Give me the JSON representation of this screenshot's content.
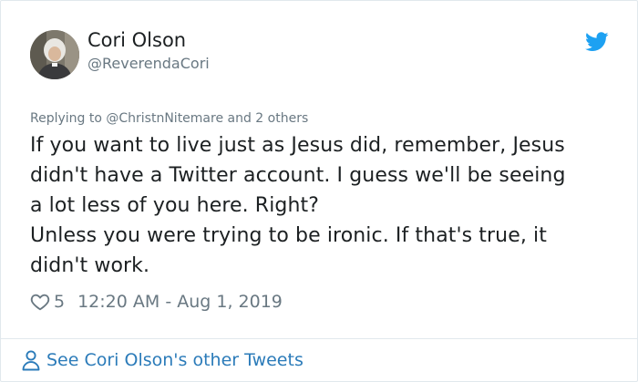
{
  "author": {
    "name": "Cori Olson",
    "handle": "@ReverendaCori"
  },
  "icons": {
    "brand": "twitter-bird-icon",
    "like": "heart-outline-icon",
    "profile": "person-outline-icon"
  },
  "reply": {
    "text": "Replying to @ChristnNitemare and 2 others"
  },
  "tweet": {
    "lines": [
      "If you want to live just as Jesus did, remember, Jesus",
      "didn't have a Twitter account. I guess we'll be seeing",
      "a lot less of you here. Right?",
      "Unless you were trying to be ironic. If that's true, it",
      "didn't work."
    ]
  },
  "meta": {
    "likes": "5",
    "timestamp": "12:20 AM - Aug 1, 2019"
  },
  "footer": {
    "see_more": "See Cori Olson's other Tweets"
  },
  "colors": {
    "brand_blue": "#1da1f2",
    "link_blue": "#2b7bb9",
    "muted_gray": "#697882",
    "text": "#1c2022",
    "border": "#e1e8ed"
  }
}
